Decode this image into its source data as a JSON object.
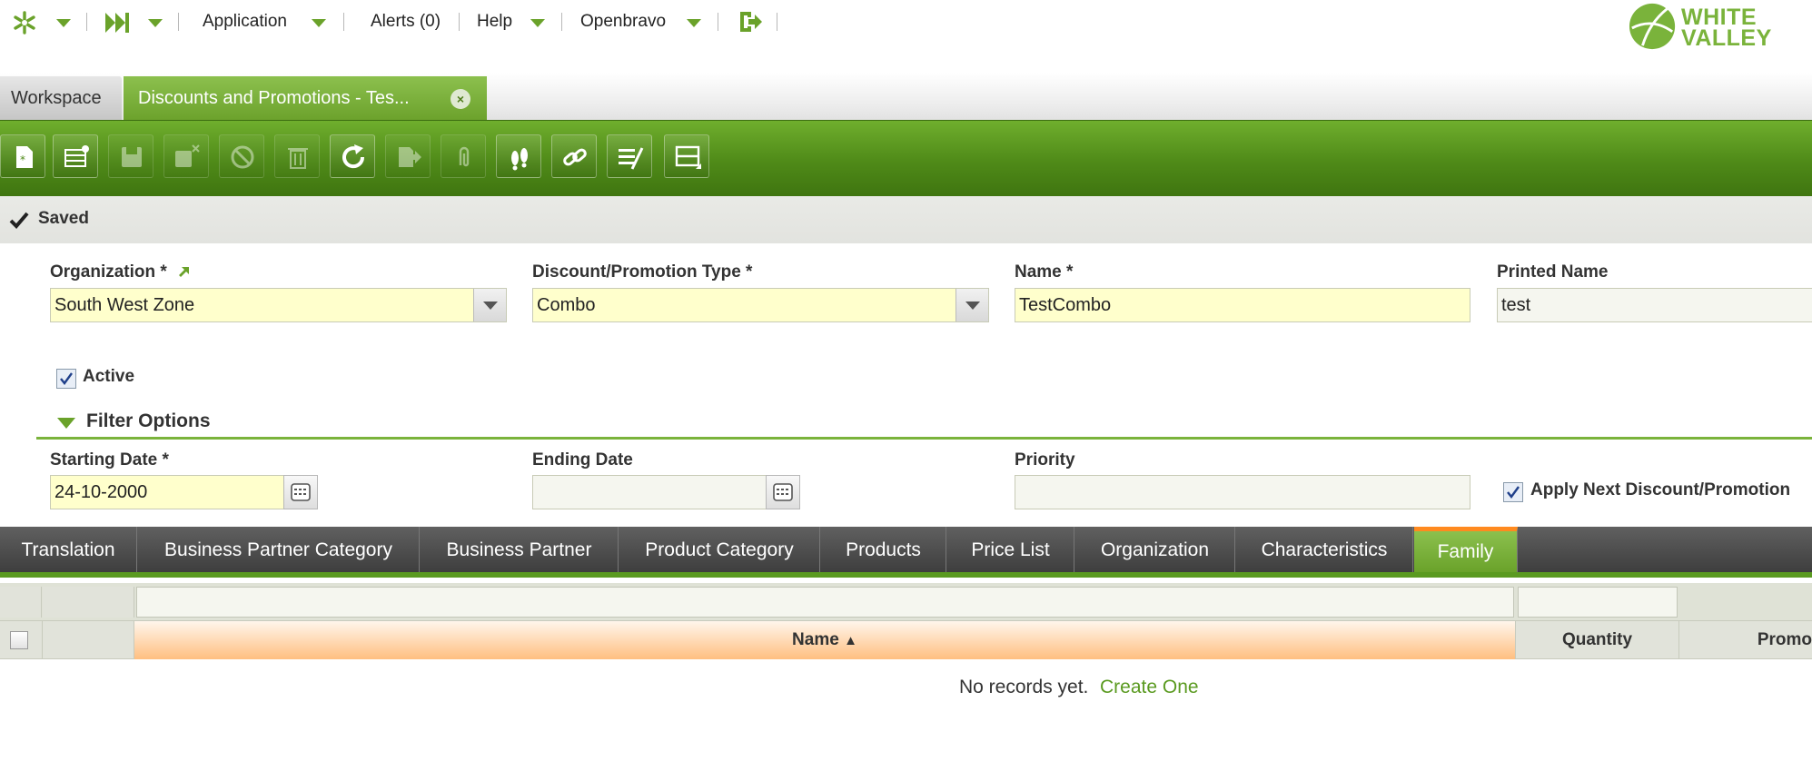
{
  "topbar": {
    "application": "Application",
    "alerts": "Alerts (0)",
    "help": "Help",
    "user": "Openbravo",
    "logo_line1": "WHITE",
    "logo_line2": "VALLEY"
  },
  "window_tabs": {
    "workspace": "Workspace",
    "active": "Discounts and Promotions - Tes...",
    "close": "×"
  },
  "toolbar": {
    "buttons": [
      "new-document",
      "new-row",
      "save",
      "save-close",
      "undo",
      "delete",
      "refresh",
      "export",
      "attach",
      "audit-trail",
      "link",
      "tools",
      "form-grid-toggle"
    ]
  },
  "status": {
    "text": "Saved"
  },
  "form": {
    "organization_label": "Organization *",
    "organization_value": "South West Zone",
    "type_label": "Discount/Promotion Type *",
    "type_value": "Combo",
    "name_label": "Name *",
    "name_value": "TestCombo",
    "printed_name_label": "Printed Name",
    "printed_name_value": "test",
    "active_label": "Active",
    "active_checked": true,
    "filter_section": "Filter Options",
    "starting_date_label": "Starting Date *",
    "starting_date_value": "24-10-2000",
    "ending_date_label": "Ending Date",
    "ending_date_value": "",
    "priority_label": "Priority",
    "priority_value": "",
    "apply_next_label": "Apply Next Discount/Promotion",
    "apply_next_checked": true
  },
  "child_tabs": [
    {
      "label": "Translation"
    },
    {
      "label": "Business Partner Category"
    },
    {
      "label": "Business Partner"
    },
    {
      "label": "Product Category"
    },
    {
      "label": "Products"
    },
    {
      "label": "Price List"
    },
    {
      "label": "Organization"
    },
    {
      "label": "Characteristics"
    },
    {
      "label": "Family",
      "active": true
    }
  ],
  "grid": {
    "columns": [
      "Name",
      "Quantity",
      "Promo"
    ],
    "sort_indicator": "▲",
    "empty_text": "No records yet.",
    "create_link": "Create One"
  },
  "colors": {
    "accent_green": "#6aa22a",
    "required_field": "#ffffcc",
    "active_tab_border": "#ff8a1f"
  }
}
